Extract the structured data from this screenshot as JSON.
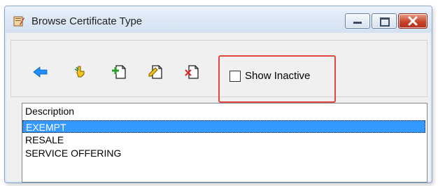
{
  "window": {
    "title": "Browse Certificate Type",
    "controls": {
      "minimize": "minimize",
      "maximize": "maximize",
      "close": "close"
    }
  },
  "toolbar": {
    "buttons": [
      {
        "name": "back",
        "icon": "arrow-left-icon",
        "color": "#1e90ff"
      },
      {
        "name": "select",
        "icon": "finger-select-icon",
        "color": "#e0b000"
      },
      {
        "name": "add",
        "icon": "page-add-icon",
        "color": "#2ca02c"
      },
      {
        "name": "edit",
        "icon": "page-edit-icon",
        "color": "#e0b000"
      },
      {
        "name": "delete",
        "icon": "page-delete-icon",
        "color": "#e02020"
      }
    ],
    "show_inactive": {
      "label": "Show Inactive",
      "checked": false
    }
  },
  "grid": {
    "columns": [
      "Description"
    ],
    "rows": [
      "EXEMPT",
      "RESALE",
      "SERVICE OFFERING"
    ],
    "selected_index": 0,
    "selection_color": "#3399ff"
  },
  "annotation_color": "#e0473e"
}
